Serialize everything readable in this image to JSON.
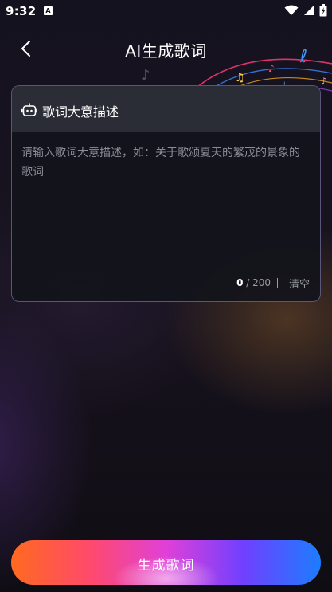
{
  "status_bar": {
    "time": "9:32",
    "app_badge": "A",
    "icons": [
      "wifi-icon",
      "signal-icon",
      "battery-icon"
    ]
  },
  "header": {
    "title": "AI生成歌词",
    "back_icon": "chevron-left-icon"
  },
  "card": {
    "icon": "robot-icon",
    "title": "歌词大意描述",
    "input_value": "",
    "input_placeholder": "请输入歌词大意描述，如：关于歌颂夏天的繁茂的景象的歌词",
    "counter_current": "0",
    "counter_max": " / 200",
    "clear_label": "清空"
  },
  "footer": {
    "generate_label": "生成歌词"
  },
  "colors": {
    "background": "#15121f",
    "card_header": "#2a2d35",
    "card_border": "#9c8fcc",
    "gradient_start": "#ff6a1f",
    "gradient_mid": "#e040d8",
    "gradient_end": "#1c7dff"
  }
}
